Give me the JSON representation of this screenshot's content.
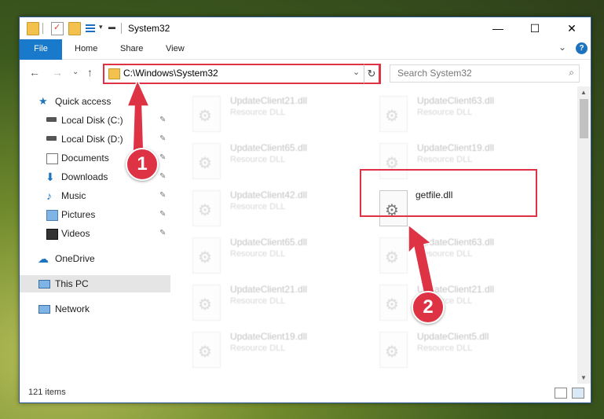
{
  "window": {
    "title": "System32",
    "min_glyph": "—",
    "max_glyph": "☐",
    "close_glyph": "✕"
  },
  "ribbon": {
    "tabs": [
      "File",
      "Home",
      "Share",
      "View"
    ],
    "collapse_glyph": "⌄",
    "help_glyph": "?"
  },
  "nav": {
    "back": "←",
    "forward": "→",
    "recent": "⌄",
    "up": "↑",
    "address": "C:\\Windows\\System32",
    "address_dropdown": "⌄",
    "refresh": "↻",
    "search_placeholder": "Search System32",
    "search_icon": "⌕"
  },
  "sidebar": {
    "quick_access": "Quick access",
    "items": [
      {
        "label": "Local Disk (C:)",
        "icon": "drive-icon",
        "pinned": true
      },
      {
        "label": "Local Disk (D:)",
        "icon": "drive-icon",
        "pinned": true
      },
      {
        "label": "Documents",
        "icon": "documents-icon",
        "pinned": true
      },
      {
        "label": "Downloads",
        "icon": "downloads-icon",
        "pinned": true
      },
      {
        "label": "Music",
        "icon": "music-icon",
        "pinned": true
      },
      {
        "label": "Pictures",
        "icon": "pictures-icon",
        "pinned": true
      },
      {
        "label": "Videos",
        "icon": "videos-icon",
        "pinned": true
      }
    ],
    "pin_glyph": "📌",
    "onedrive": "OneDrive",
    "this_pc": "This PC",
    "network": "Network"
  },
  "files": {
    "left_column": [
      {
        "name": "UpdateClient21.dll",
        "type": "Resource DLL"
      },
      {
        "name": "UpdateClient65.dll",
        "type": "Resource DLL"
      },
      {
        "name": "UpdateClient42.dll",
        "type": "Resource DLL"
      },
      {
        "name": "UpdateClient65.dll",
        "type": "Resource DLL"
      },
      {
        "name": "UpdateClient21.dll",
        "type": "Resource DLL"
      },
      {
        "name": "UpdateClient19.dll",
        "type": "Resource DLL"
      }
    ],
    "right_column": [
      {
        "name": "UpdateClient63.dll",
        "type": "Resource DLL"
      },
      {
        "name": "UpdateClient19.dll",
        "type": "Resource DLL"
      },
      {
        "name": "getfile.dll",
        "type": ""
      },
      {
        "name": "UpdateClient63.dll",
        "type": "Resource DLL"
      },
      {
        "name": "UpdateClient21.dll",
        "type": "Resource DLL"
      },
      {
        "name": "UpdateClient5.dll",
        "type": "Resource DLL"
      }
    ]
  },
  "status": {
    "item_count": "121 items"
  },
  "annotations": {
    "step1": "1",
    "step2": "2",
    "accent": "#dd3344"
  }
}
